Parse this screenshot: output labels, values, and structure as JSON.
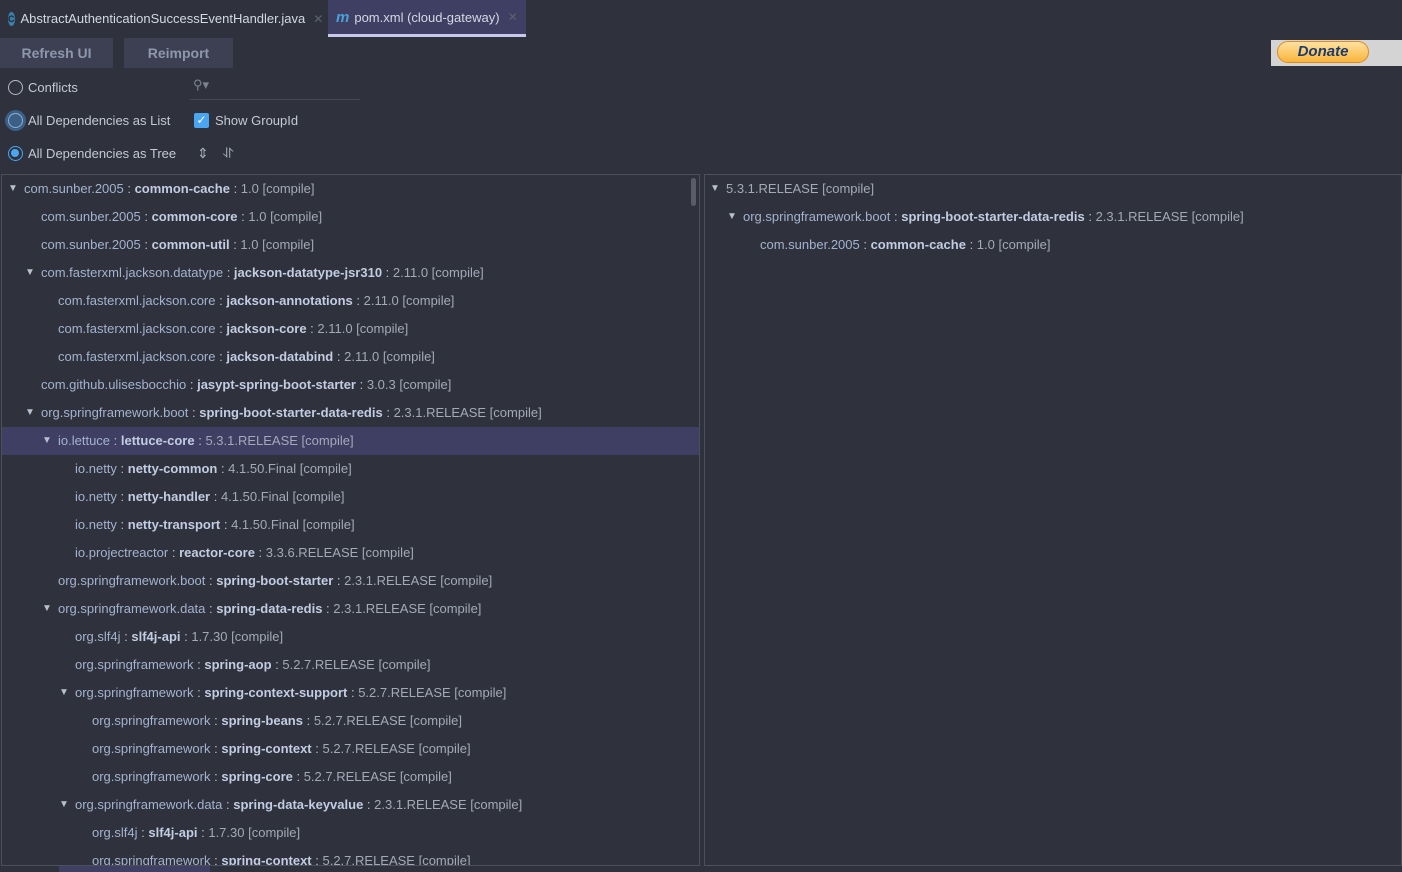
{
  "tabs": [
    {
      "label": "AbstractAuthenticationSuccessEventHandler.java",
      "icon": "class-icon",
      "active": false
    },
    {
      "label": "pom.xml (cloud-gateway)",
      "icon": "maven-icon",
      "active": true
    }
  ],
  "toolbar": {
    "refresh_label": "Refresh UI",
    "reimport_label": "Reimport",
    "donate_label": "Donate"
  },
  "options": {
    "conflicts": "Conflicts",
    "as_list": "All Dependencies as List",
    "as_tree": "All Dependencies as Tree",
    "selected": "All Dependencies as Tree",
    "show_groupid": "Show GroupId",
    "show_groupid_checked": true,
    "search_placeholder": ""
  },
  "colors": {
    "background": "#2f323c",
    "selection": "#3f3f63",
    "accent": "#4aa6f0"
  },
  "tree": [
    {
      "level": 0,
      "expanded": true,
      "group": "com.sunber.2005",
      "artifact": "common-cache",
      "version": "1.0 [compile]"
    },
    {
      "level": 1,
      "group": "com.sunber.2005",
      "artifact": "common-core",
      "version": "1.0 [compile]"
    },
    {
      "level": 1,
      "group": "com.sunber.2005",
      "artifact": "common-util",
      "version": "1.0 [compile]"
    },
    {
      "level": 1,
      "expanded": true,
      "group": "com.fasterxml.jackson.datatype",
      "artifact": "jackson-datatype-jsr310",
      "version": "2.11.0 [compile]"
    },
    {
      "level": 2,
      "group": "com.fasterxml.jackson.core",
      "artifact": "jackson-annotations",
      "version": "2.11.0 [compile]"
    },
    {
      "level": 2,
      "group": "com.fasterxml.jackson.core",
      "artifact": "jackson-core",
      "version": "2.11.0 [compile]"
    },
    {
      "level": 2,
      "group": "com.fasterxml.jackson.core",
      "artifact": "jackson-databind",
      "version": "2.11.0 [compile]"
    },
    {
      "level": 1,
      "group": "com.github.ulisesbocchio",
      "artifact": "jasypt-spring-boot-starter",
      "version": "3.0.3 [compile]"
    },
    {
      "level": 1,
      "expanded": true,
      "group": "org.springframework.boot",
      "artifact": "spring-boot-starter-data-redis",
      "version": "2.3.1.RELEASE [compile]"
    },
    {
      "level": 2,
      "expanded": true,
      "selected": true,
      "group": "io.lettuce",
      "artifact": "lettuce-core",
      "version": "5.3.1.RELEASE [compile]"
    },
    {
      "level": 3,
      "group": "io.netty",
      "artifact": "netty-common",
      "version": "4.1.50.Final [compile]"
    },
    {
      "level": 3,
      "group": "io.netty",
      "artifact": "netty-handler",
      "version": "4.1.50.Final [compile]"
    },
    {
      "level": 3,
      "group": "io.netty",
      "artifact": "netty-transport",
      "version": "4.1.50.Final [compile]"
    },
    {
      "level": 3,
      "group": "io.projectreactor",
      "artifact": "reactor-core",
      "version": "3.3.6.RELEASE [compile]"
    },
    {
      "level": 2,
      "group": "org.springframework.boot",
      "artifact": "spring-boot-starter",
      "version": "2.3.1.RELEASE [compile]"
    },
    {
      "level": 2,
      "expanded": true,
      "group": "org.springframework.data",
      "artifact": "spring-data-redis",
      "version": "2.3.1.RELEASE [compile]"
    },
    {
      "level": 3,
      "group": "org.slf4j",
      "artifact": "slf4j-api",
      "version": "1.7.30 [compile]"
    },
    {
      "level": 3,
      "group": "org.springframework",
      "artifact": "spring-aop",
      "version": "5.2.7.RELEASE [compile]"
    },
    {
      "level": 3,
      "expanded": true,
      "group": "org.springframework",
      "artifact": "spring-context-support",
      "version": "5.2.7.RELEASE [compile]"
    },
    {
      "level": 4,
      "group": "org.springframework",
      "artifact": "spring-beans",
      "version": "5.2.7.RELEASE [compile]"
    },
    {
      "level": 4,
      "group": "org.springframework",
      "artifact": "spring-context",
      "version": "5.2.7.RELEASE [compile]"
    },
    {
      "level": 4,
      "group": "org.springframework",
      "artifact": "spring-core",
      "version": "5.2.7.RELEASE [compile]"
    },
    {
      "level": 3,
      "expanded": true,
      "group": "org.springframework.data",
      "artifact": "spring-data-keyvalue",
      "version": "2.3.1.RELEASE [compile]"
    },
    {
      "level": 4,
      "group": "org.slf4j",
      "artifact": "slf4j-api",
      "version": "1.7.30 [compile]"
    },
    {
      "level": 4,
      "group": "org.springframework",
      "artifact": "spring-context",
      "version": "5.2.7.RELEASE [compile]"
    }
  ],
  "usages": [
    {
      "level": 0,
      "expanded": true,
      "version": "5.3.1.RELEASE [compile]"
    },
    {
      "level": 1,
      "expanded": true,
      "group": "org.springframework.boot",
      "artifact": "spring-boot-starter-data-redis",
      "version": "2.3.1.RELEASE [compile]"
    },
    {
      "level": 2,
      "group": "com.sunber.2005",
      "artifact": "common-cache",
      "version": "1.0 [compile]"
    }
  ]
}
